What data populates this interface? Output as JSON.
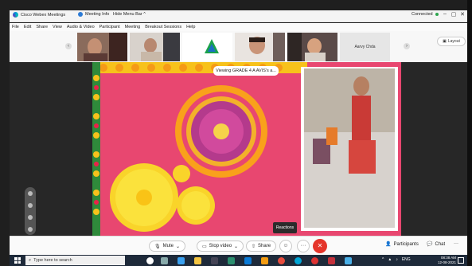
{
  "window": {
    "app_title": "Cisco Webex Meetings",
    "meeting_info": "Meeting Info",
    "hide_menu_bar": "Hide Menu Bar ^",
    "status": "Connected"
  },
  "menu": [
    "File",
    "Edit",
    "Share",
    "View",
    "Audio & Video",
    "Participant",
    "Meeting",
    "Breakout Sessions",
    "Help"
  ],
  "strip": {
    "participant_name": "Aarvy Chda",
    "layout_label": "Layout"
  },
  "share": {
    "banner": "Viewing GRADE 4 A AVIS's a..."
  },
  "controls": {
    "mute": "Mute",
    "stop_video": "Stop video",
    "share": "Share",
    "tooltip": "Reactions",
    "participants": "Participants",
    "chat": "Chat"
  },
  "taskbar": {
    "search_placeholder": "Type here to search",
    "lang": "ENG",
    "time": "08:38 AM",
    "date": "12-08-2021"
  },
  "colors": {
    "background": "#e84770",
    "end_button": "#e5352b",
    "accent": "#2b7bd6"
  }
}
